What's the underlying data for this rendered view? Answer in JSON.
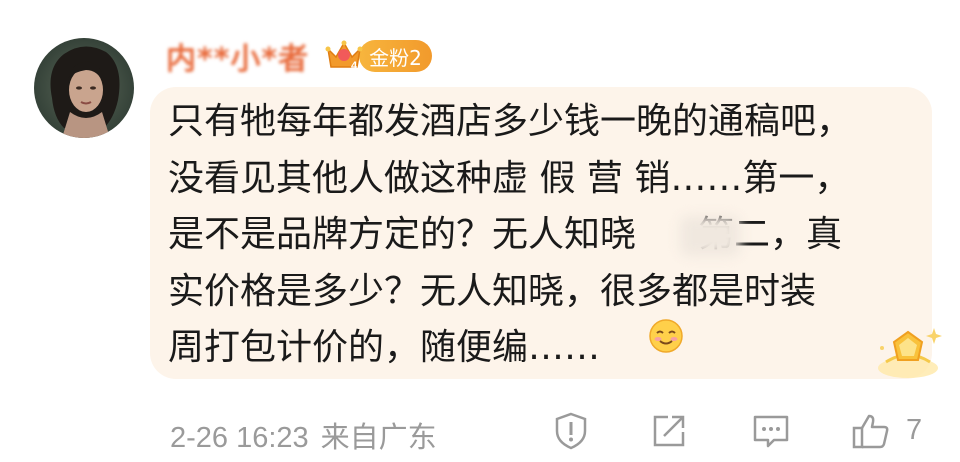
{
  "comment": {
    "username": "内**小*者",
    "fan_badge": "金粉2",
    "crown_level": "4",
    "text_lines": [
      "只有牠每年都发酒店多少钱一晚的通稿吧，",
      "没看见其他人做这种虚 假 营 销……第一，",
      "是不是品牌方定的？无人知晓",
      "第二，真",
      "实价格是多少？无人知晓，很多都是时装",
      "周打包计价的，随便编……"
    ]
  },
  "footer": {
    "timestamp": "2-26 16:23",
    "source": "来自广东",
    "like_count": "7"
  },
  "icons": {
    "report": "report-icon",
    "share": "share-icon",
    "reply": "comment-icon",
    "like": "thumbs-up-icon",
    "emoji": "smile-emoji-icon",
    "star": "star-badge-icon",
    "crown": "crown-icon"
  },
  "colors": {
    "username": "#e86a3b",
    "badge": "#f3a535",
    "bubble": "#fdf4ea",
    "meta": "#9a9a9a"
  }
}
